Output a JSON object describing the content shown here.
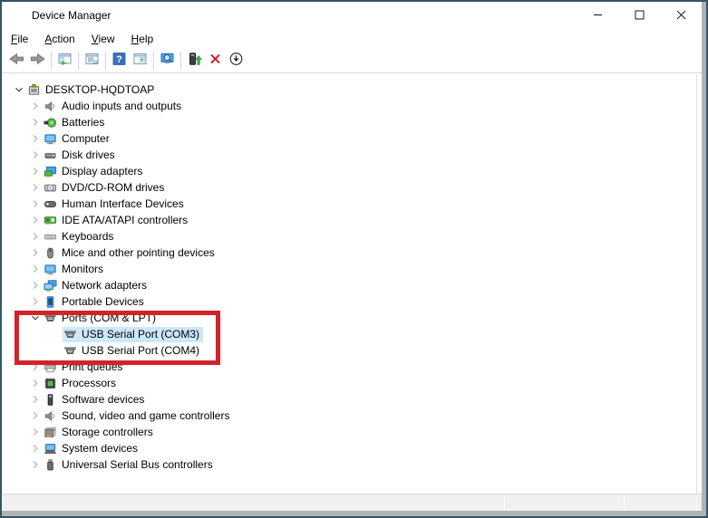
{
  "window": {
    "title": "Device Manager",
    "app_icon": "device-manager-icon",
    "controls": [
      {
        "name": "minimize",
        "icon": "minimize-icon"
      },
      {
        "name": "maximize",
        "icon": "maximize-icon"
      },
      {
        "name": "close",
        "icon": "close-icon"
      }
    ]
  },
  "menu": {
    "items": [
      {
        "label": "File"
      },
      {
        "label": "Action"
      },
      {
        "label": "View"
      },
      {
        "label": "Help"
      }
    ]
  },
  "toolbar": {
    "buttons": [
      {
        "name": "back",
        "icon": "back-icon"
      },
      {
        "name": "forward",
        "icon": "forward-icon"
      },
      {
        "name": "separator"
      },
      {
        "name": "show-hide-console-tree",
        "icon": "console-tree-icon"
      },
      {
        "name": "separator"
      },
      {
        "name": "properties",
        "icon": "properties-icon"
      },
      {
        "name": "separator"
      },
      {
        "name": "help",
        "icon": "help-icon"
      },
      {
        "name": "show-hide-action-pane",
        "icon": "action-pane-icon"
      },
      {
        "name": "separator"
      },
      {
        "name": "scan-for-hardware-changes",
        "icon": "scan-icon"
      },
      {
        "name": "separator"
      },
      {
        "name": "update-driver",
        "icon": "update-driver-icon"
      },
      {
        "name": "uninstall-device",
        "icon": "uninstall-icon"
      },
      {
        "name": "disable-device",
        "icon": "disable-icon"
      }
    ]
  },
  "tree": {
    "items": [
      {
        "label": "DESKTOP-HQDTOAP",
        "level": 0,
        "state": "expanded",
        "icon": "computer-icon",
        "selected": false
      },
      {
        "label": "Audio inputs and outputs",
        "level": 1,
        "state": "collapsed",
        "icon": "speaker-icon",
        "selected": false
      },
      {
        "label": "Batteries",
        "level": 1,
        "state": "collapsed",
        "icon": "battery-icon",
        "selected": false
      },
      {
        "label": "Computer",
        "level": 1,
        "state": "collapsed",
        "icon": "monitor-icon",
        "selected": false
      },
      {
        "label": "Disk drives",
        "level": 1,
        "state": "collapsed",
        "icon": "disk-icon",
        "selected": false
      },
      {
        "label": "Display adapters",
        "level": 1,
        "state": "collapsed",
        "icon": "display-adapter-icon",
        "selected": false
      },
      {
        "label": "DVD/CD-ROM drives",
        "level": 1,
        "state": "collapsed",
        "icon": "dvd-icon",
        "selected": false
      },
      {
        "label": "Human Interface Devices",
        "level": 1,
        "state": "collapsed",
        "icon": "gamepad-icon",
        "selected": false
      },
      {
        "label": "IDE ATA/ATAPI controllers",
        "level": 1,
        "state": "collapsed",
        "icon": "ide-controller-icon",
        "selected": false
      },
      {
        "label": "Keyboards",
        "level": 1,
        "state": "collapsed",
        "icon": "keyboard-icon",
        "selected": false
      },
      {
        "label": "Mice and other pointing devices",
        "level": 1,
        "state": "collapsed",
        "icon": "mouse-icon",
        "selected": false
      },
      {
        "label": "Monitors",
        "level": 1,
        "state": "collapsed",
        "icon": "monitor-icon",
        "selected": false
      },
      {
        "label": "Network adapters",
        "level": 1,
        "state": "collapsed",
        "icon": "network-icon",
        "selected": false
      },
      {
        "label": "Portable Devices",
        "level": 1,
        "state": "collapsed",
        "icon": "portable-device-icon",
        "selected": false
      },
      {
        "label": "Ports (COM & LPT)",
        "level": 1,
        "state": "expanded",
        "icon": "serial-port-icon",
        "selected": false
      },
      {
        "label": "USB Serial Port (COM3)",
        "level": 2,
        "state": "leaf",
        "icon": "serial-port-icon",
        "selected": true
      },
      {
        "label": "USB Serial Port (COM4)",
        "level": 2,
        "state": "leaf",
        "icon": "serial-port-icon",
        "selected": false
      },
      {
        "label": "Print queues",
        "level": 1,
        "state": "collapsed",
        "icon": "printer-icon",
        "selected": false
      },
      {
        "label": "Processors",
        "level": 1,
        "state": "collapsed",
        "icon": "processor-icon",
        "selected": false
      },
      {
        "label": "Software devices",
        "level": 1,
        "state": "collapsed",
        "icon": "software-device-icon",
        "selected": false
      },
      {
        "label": "Sound, video and game controllers",
        "level": 1,
        "state": "collapsed",
        "icon": "speaker-icon",
        "selected": false
      },
      {
        "label": "Storage controllers",
        "level": 1,
        "state": "collapsed",
        "icon": "storage-icon",
        "selected": false
      },
      {
        "label": "System devices",
        "level": 1,
        "state": "collapsed",
        "icon": "system-device-icon",
        "selected": false
      },
      {
        "label": "Universal Serial Bus controllers",
        "level": 1,
        "state": "collapsed",
        "icon": "usb-icon",
        "selected": false
      }
    ]
  },
  "highlight": {
    "shape": "rectangle",
    "color": "#d2232a"
  },
  "statusbar": {
    "panes": [
      "",
      "",
      ""
    ]
  },
  "colors": {
    "selection": "#cce8ff",
    "window_border": "#32566b",
    "frame_gray": "#b3b3b3",
    "statusbar_bg": "#f0f0f0",
    "highlight_red": "#d2232a"
  }
}
